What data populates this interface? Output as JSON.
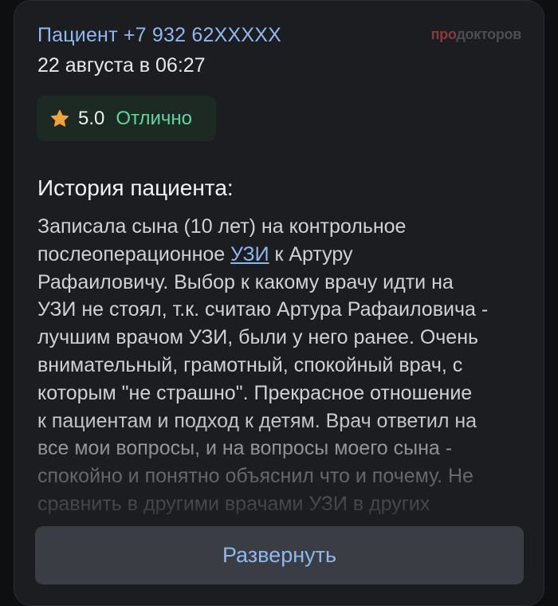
{
  "review": {
    "author": "Пациент +7 932 62XXXXX",
    "date": "22 августа в 06:27",
    "brand_pro": "про",
    "brand_rest": "докторов",
    "rating": {
      "score": "5.0",
      "label": "Отлично",
      "star_color": "#f0a33a",
      "label_color": "#5fd79a"
    },
    "section_title": "История пациента:",
    "text": {
      "line1": "Записала сына (10 лет) на контрольное",
      "line2_before": "послеоперационное ",
      "line2_link": "УЗИ",
      "line2_after": " к Артуру",
      "line3": "Рафаиловичу. Выбор к какому врачу идти на",
      "line4": "УЗИ не стоял, т.к. считаю Артура Рафаиловича -",
      "line5": "лучшим врачом УЗИ, были у него ранее. Очень",
      "line6": "внимательный, грамотный, спокойный врач, с",
      "line7": "которым \"не страшно\". Прекрасное отношение",
      "line8": "к пациентам и подход к детям. Врач ответил на",
      "line9": "все мои вопросы, и на вопросы моего сына -",
      "line10": "спокойно и понятно объяснил что и почему. Не",
      "line11": "сравнить в другими врачами УЗИ в других"
    },
    "expand_label": "Развернуть"
  }
}
